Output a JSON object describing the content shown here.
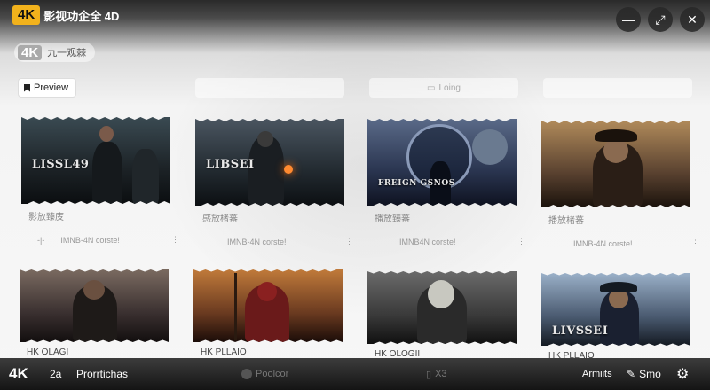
{
  "app": {
    "badge": "4K",
    "title": "影视功企全 4D"
  },
  "window_controls": {
    "minimize": "—",
    "maximize": "⤢",
    "close": "✕"
  },
  "sublogo": {
    "badge": "4K",
    "text": "九一观棘"
  },
  "tabs": [
    {
      "label": "Preview",
      "active": true
    },
    {
      "label": ""
    },
    {
      "label": "Loing"
    },
    {
      "label": ""
    }
  ],
  "cards": [
    {
      "poster_title": "LISSL49",
      "subtitle": "影放臻庋",
      "meta_left": "-|-",
      "meta_right": "IMNB-4N corste!",
      "palette": [
        "#3a4a52",
        "#1c2226",
        "#0b0e10"
      ]
    },
    {
      "poster_title": "LIBSEI",
      "subtitle": "感放楮蕃",
      "meta_left": "",
      "meta_right": "IMNB-4N corste!",
      "palette": [
        "#4a5560",
        "#222a30",
        "#0c0f12"
      ]
    },
    {
      "poster_title": "FREIGN GSNOS",
      "subtitle": "播放臻蕃",
      "meta_left": "",
      "meta_right": "IMNB4N corste!",
      "palette": [
        "#5a6a88",
        "#2a3550",
        "#0e1220"
      ]
    },
    {
      "poster_title": "",
      "subtitle": "播放楮蕃",
      "meta_left": "",
      "meta_right": "IMNB-4N corste!",
      "palette": [
        "#b08a5a",
        "#5a4230",
        "#1a120c"
      ]
    },
    {
      "poster_title": "",
      "subtitle": "HK OLAGI",
      "meta_left": "",
      "meta_right": "",
      "palette": [
        "#7a6a60",
        "#3a3030",
        "#120e0e"
      ]
    },
    {
      "poster_title": "",
      "subtitle": "HK PLLAIO",
      "meta_left": "",
      "meta_right": "",
      "palette": [
        "#c07a3a",
        "#6a3a20",
        "#1a0c08"
      ]
    },
    {
      "poster_title": "",
      "subtitle": "HK OLOGII",
      "meta_left": "",
      "meta_right": "",
      "palette": [
        "#6a6a6a",
        "#3a3a3a",
        "#101010"
      ]
    },
    {
      "poster_title": "LIVSSEI",
      "subtitle": "HK PLLAIO",
      "meta_left": "",
      "meta_right": "",
      "palette": [
        "#9ab0c8",
        "#4a5a70",
        "#141a22"
      ]
    }
  ],
  "bottombar": {
    "badge": "4K",
    "item1": "2a",
    "item2": "Prorrtichas",
    "item3": "Poolcor",
    "item4": "X3",
    "item5": "Armiits",
    "item6": "Smo",
    "gear": "⚙"
  }
}
